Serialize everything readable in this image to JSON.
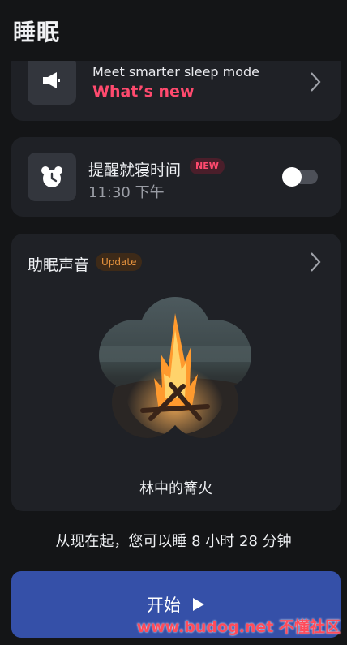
{
  "header": {
    "title": "睡眠"
  },
  "promo": {
    "line1": "Meet smarter sleep mode",
    "line2": "What’s new"
  },
  "reminder": {
    "title": "提醒就寝时间",
    "badge": "NEW",
    "time": "11:30 下午",
    "enabled": false
  },
  "sound": {
    "title": "助眠声音",
    "badge": "Update",
    "name": "林中的篝火"
  },
  "info": "从现在起，您可以睡 8 小时 28 分钟",
  "start_button": {
    "label": "开始"
  },
  "watermark": "www.budog.net 不懂社区",
  "colors": {
    "accent_red": "#ff4a6e",
    "update_orange": "#e8943e",
    "button_blue": "#3550a8"
  },
  "icons": {
    "promo": "megaphone-icon",
    "reminder": "alarm-clock-bear-icon"
  }
}
